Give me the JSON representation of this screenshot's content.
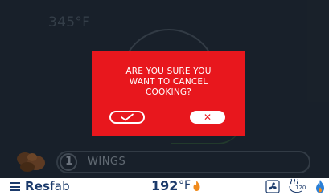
{
  "display": {
    "set_temperature": "345°F",
    "recipe": {
      "quantity": "1",
      "name": "WINGS"
    }
  },
  "dialog": {
    "message_line1": "ARE YOU SURE YOU",
    "message_line2": "WANT TO CANCEL",
    "message_line3": "COOKING?",
    "confirm_icon": "checkmark-icon",
    "cancel_label": "✕"
  },
  "statusbar": {
    "brand_prefix": "Res",
    "brand_suffix": "fab",
    "oven_temperature": "192",
    "oven_unit": "°F",
    "steam_value": "120"
  },
  "colors": {
    "dialog_background": "#e8171d",
    "display_background": "#1c2530",
    "brand_navy": "#1b3a6b",
    "flame_orange": "#f08a1c",
    "heat_blue": "#2a7fd6"
  }
}
